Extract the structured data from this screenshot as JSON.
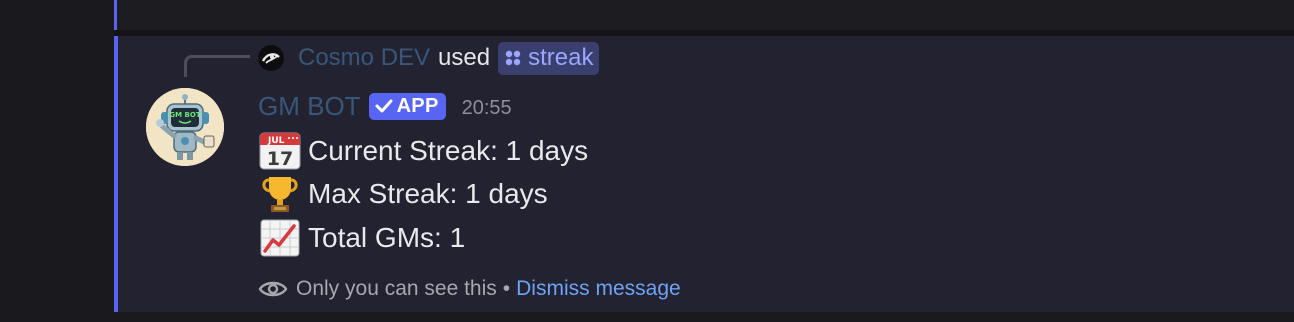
{
  "reply": {
    "user_name": "Cosmo DEV",
    "used_text": "used",
    "command": "streak",
    "avatar_icon": "cosmo-avatar-icon",
    "command_icon": "app-command-icon"
  },
  "message": {
    "author": "GM BOT",
    "badge": "APP",
    "badge_icon": "checkmark-icon",
    "timestamp": "20:55",
    "avatar_label": "GM BOT",
    "lines": [
      {
        "icon": "calendar-icon",
        "text": "Current Streak: 1 days"
      },
      {
        "icon": "trophy-icon",
        "text": "Max Streak: 1 days"
      },
      {
        "icon": "chart-increasing-icon",
        "text": "Total GMs: 1"
      }
    ],
    "footer": {
      "note": "Only you can see this",
      "separator": "•",
      "dismiss": "Dismiss message",
      "eye_icon": "eye-icon"
    }
  },
  "colors": {
    "accent": "#5865f2",
    "username": "#38577a",
    "link": "#6ea3f5",
    "text": "#e8e9eb",
    "message_bg": "#222230"
  }
}
